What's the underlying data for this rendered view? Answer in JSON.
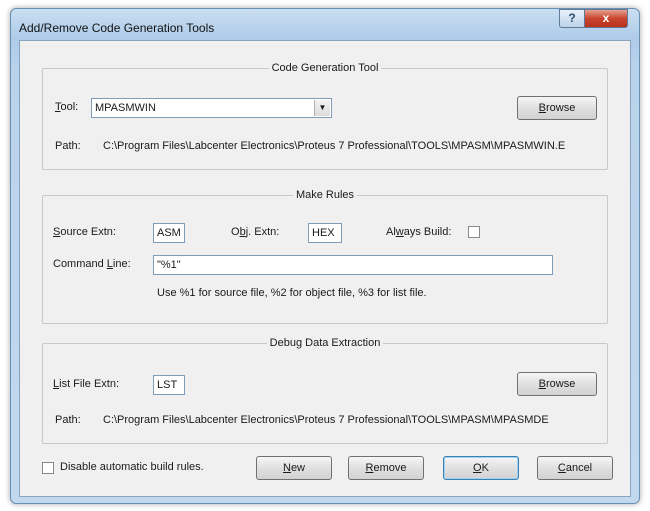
{
  "window": {
    "title": "Add/Remove Code Generation Tools",
    "help_label": "?",
    "close_label": "x"
  },
  "code_generation": {
    "group_title": "Code Generation Tool",
    "tool_label_u": "T",
    "tool_label_rest": "ool:",
    "tool_value": "MPASMWIN",
    "browse_label_u": "B",
    "browse_label_rest": "rowse",
    "path_label": "Path:",
    "path_value": "C:\\Program Files\\Labcenter Electronics\\Proteus 7 Professional\\TOOLS\\MPASM\\MPASMWIN.E"
  },
  "make_rules": {
    "group_title": "Make Rules",
    "source_label_u": "S",
    "source_label_rest": "ource Extn:",
    "source_value": "ASM",
    "obj_label_pre": "O",
    "obj_label_u": "b",
    "obj_label_rest": "j. Extn:",
    "obj_value": "HEX",
    "always_label_pre": "Al",
    "always_label_u": "w",
    "always_label_rest": "ays Build:",
    "command_label_pre": "Command ",
    "command_label_u": "L",
    "command_label_rest": "ine:",
    "command_value": "\"%1\"",
    "hint": "Use %1 for source file, %2 for object file, %3 for list file."
  },
  "debug": {
    "group_title": "Debug Data Extraction",
    "list_label_u": "L",
    "list_label_rest": "ist File Extn:",
    "list_value": "LST",
    "browse_label_u": "B",
    "browse_label_rest": "rowse",
    "path_label": "Path:",
    "path_value": "C:\\Program Files\\Labcenter Electronics\\Proteus 7 Professional\\TOOLS\\MPASM\\MPASMDE"
  },
  "footer": {
    "disable_label": "Disable automatic build rules.",
    "new_u": "N",
    "new_rest": "ew",
    "remove_u": "R",
    "remove_rest": "emove",
    "ok_u": "O",
    "ok_rest": "K",
    "cancel_u": "C",
    "cancel_rest": "ancel"
  }
}
